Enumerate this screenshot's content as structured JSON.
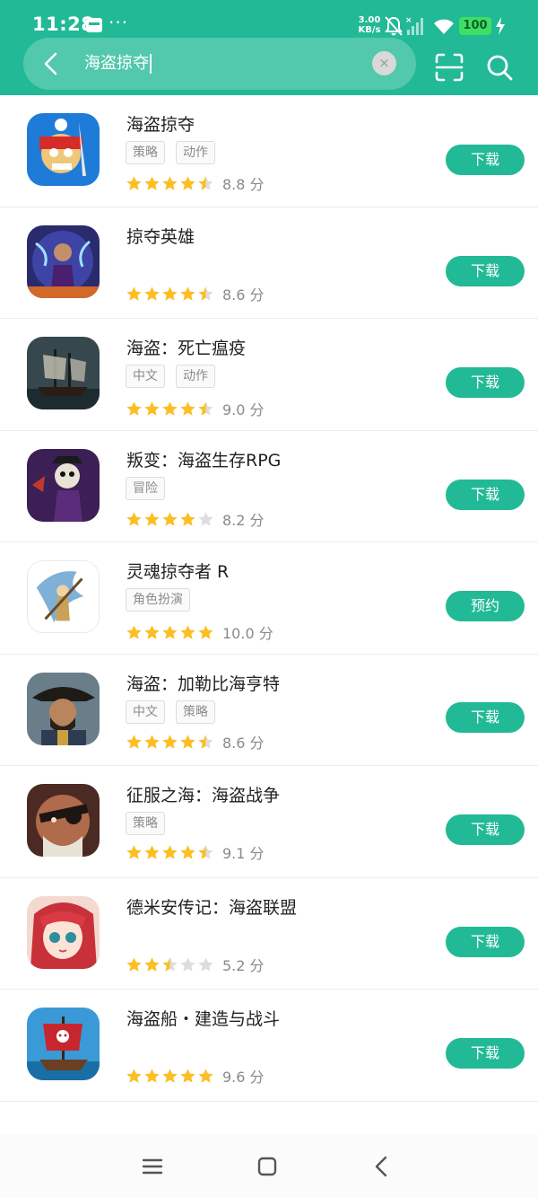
{
  "status_bar": {
    "time": "11:28",
    "dots": "···",
    "net_speed_value": "3.00",
    "net_speed_unit": "KB/s",
    "battery": "100",
    "icons": [
      "notification-icon",
      "mute-icon",
      "signal-icon",
      "wifi-icon",
      "battery-icon",
      "charging-icon"
    ]
  },
  "search": {
    "query": "海盗掠夺",
    "clear_glyph": "×"
  },
  "colors": {
    "accent": "#22b996",
    "star": "#fbbf24",
    "star_empty": "#dddddd"
  },
  "apps": [
    {
      "name": "海盗掠夺",
      "tags": [
        "策略",
        "动作"
      ],
      "rating": 4.5,
      "score": "8.8 分",
      "action": "下载"
    },
    {
      "name": "掠夺英雄",
      "tags": [],
      "rating": 4.5,
      "score": "8.6 分",
      "action": "下载"
    },
    {
      "name": "海盗：死亡瘟疫",
      "tags": [
        "中文",
        "动作"
      ],
      "rating": 4.5,
      "score": "9.0 分",
      "action": "下载"
    },
    {
      "name": "叛变：海盗生存RPG",
      "tags": [
        "冒险"
      ],
      "rating": 4,
      "score": "8.2 分",
      "action": "下载"
    },
    {
      "name": "灵魂掠夺者 R",
      "tags": [
        "角色扮演"
      ],
      "rating": 5,
      "score": "10.0 分",
      "action": "预约"
    },
    {
      "name": "海盗：加勒比海亨特",
      "tags": [
        "中文",
        "策略"
      ],
      "rating": 4.5,
      "score": "8.6 分",
      "action": "下载"
    },
    {
      "name": "征服之海：海盗战争",
      "tags": [
        "策略"
      ],
      "rating": 4.5,
      "score": "9.1 分",
      "action": "下载"
    },
    {
      "name": "德米安传记：海盗联盟",
      "tags": [],
      "rating": 2.5,
      "score": "5.2 分",
      "action": "下载"
    },
    {
      "name": "海盗船・建造与战斗",
      "tags": [],
      "rating": 5,
      "score": "9.6 分",
      "action": "下载"
    }
  ],
  "nav": {
    "icons": [
      "menu-icon",
      "home-icon",
      "back-icon"
    ]
  }
}
